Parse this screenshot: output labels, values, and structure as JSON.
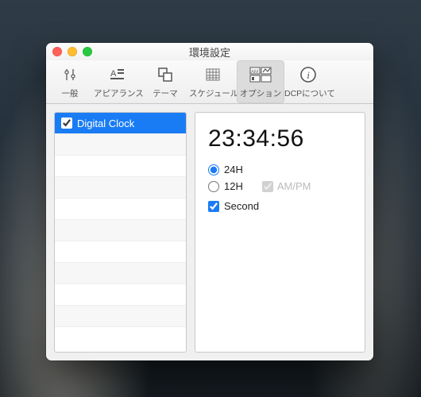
{
  "window": {
    "title": "環境設定"
  },
  "toolbar": {
    "items": [
      {
        "label": "一般"
      },
      {
        "label": "アピアランス"
      },
      {
        "label": "テーマ"
      },
      {
        "label": "スケジュール"
      },
      {
        "label": "オプション"
      },
      {
        "label": "DCPについて"
      }
    ],
    "selected_index": 4
  },
  "sidebar": {
    "items": [
      {
        "label": "Digital Clock",
        "checked": true
      }
    ]
  },
  "clock": {
    "display": "23:34:56"
  },
  "options": {
    "h24_label": "24H",
    "h12_label": "12H",
    "ampm_label": "AM/PM",
    "second_label": "Second",
    "mode": "24H",
    "ampm_checked": true,
    "ampm_enabled": false,
    "second_checked": true
  },
  "colors": {
    "accent": "#1a7cf5"
  }
}
